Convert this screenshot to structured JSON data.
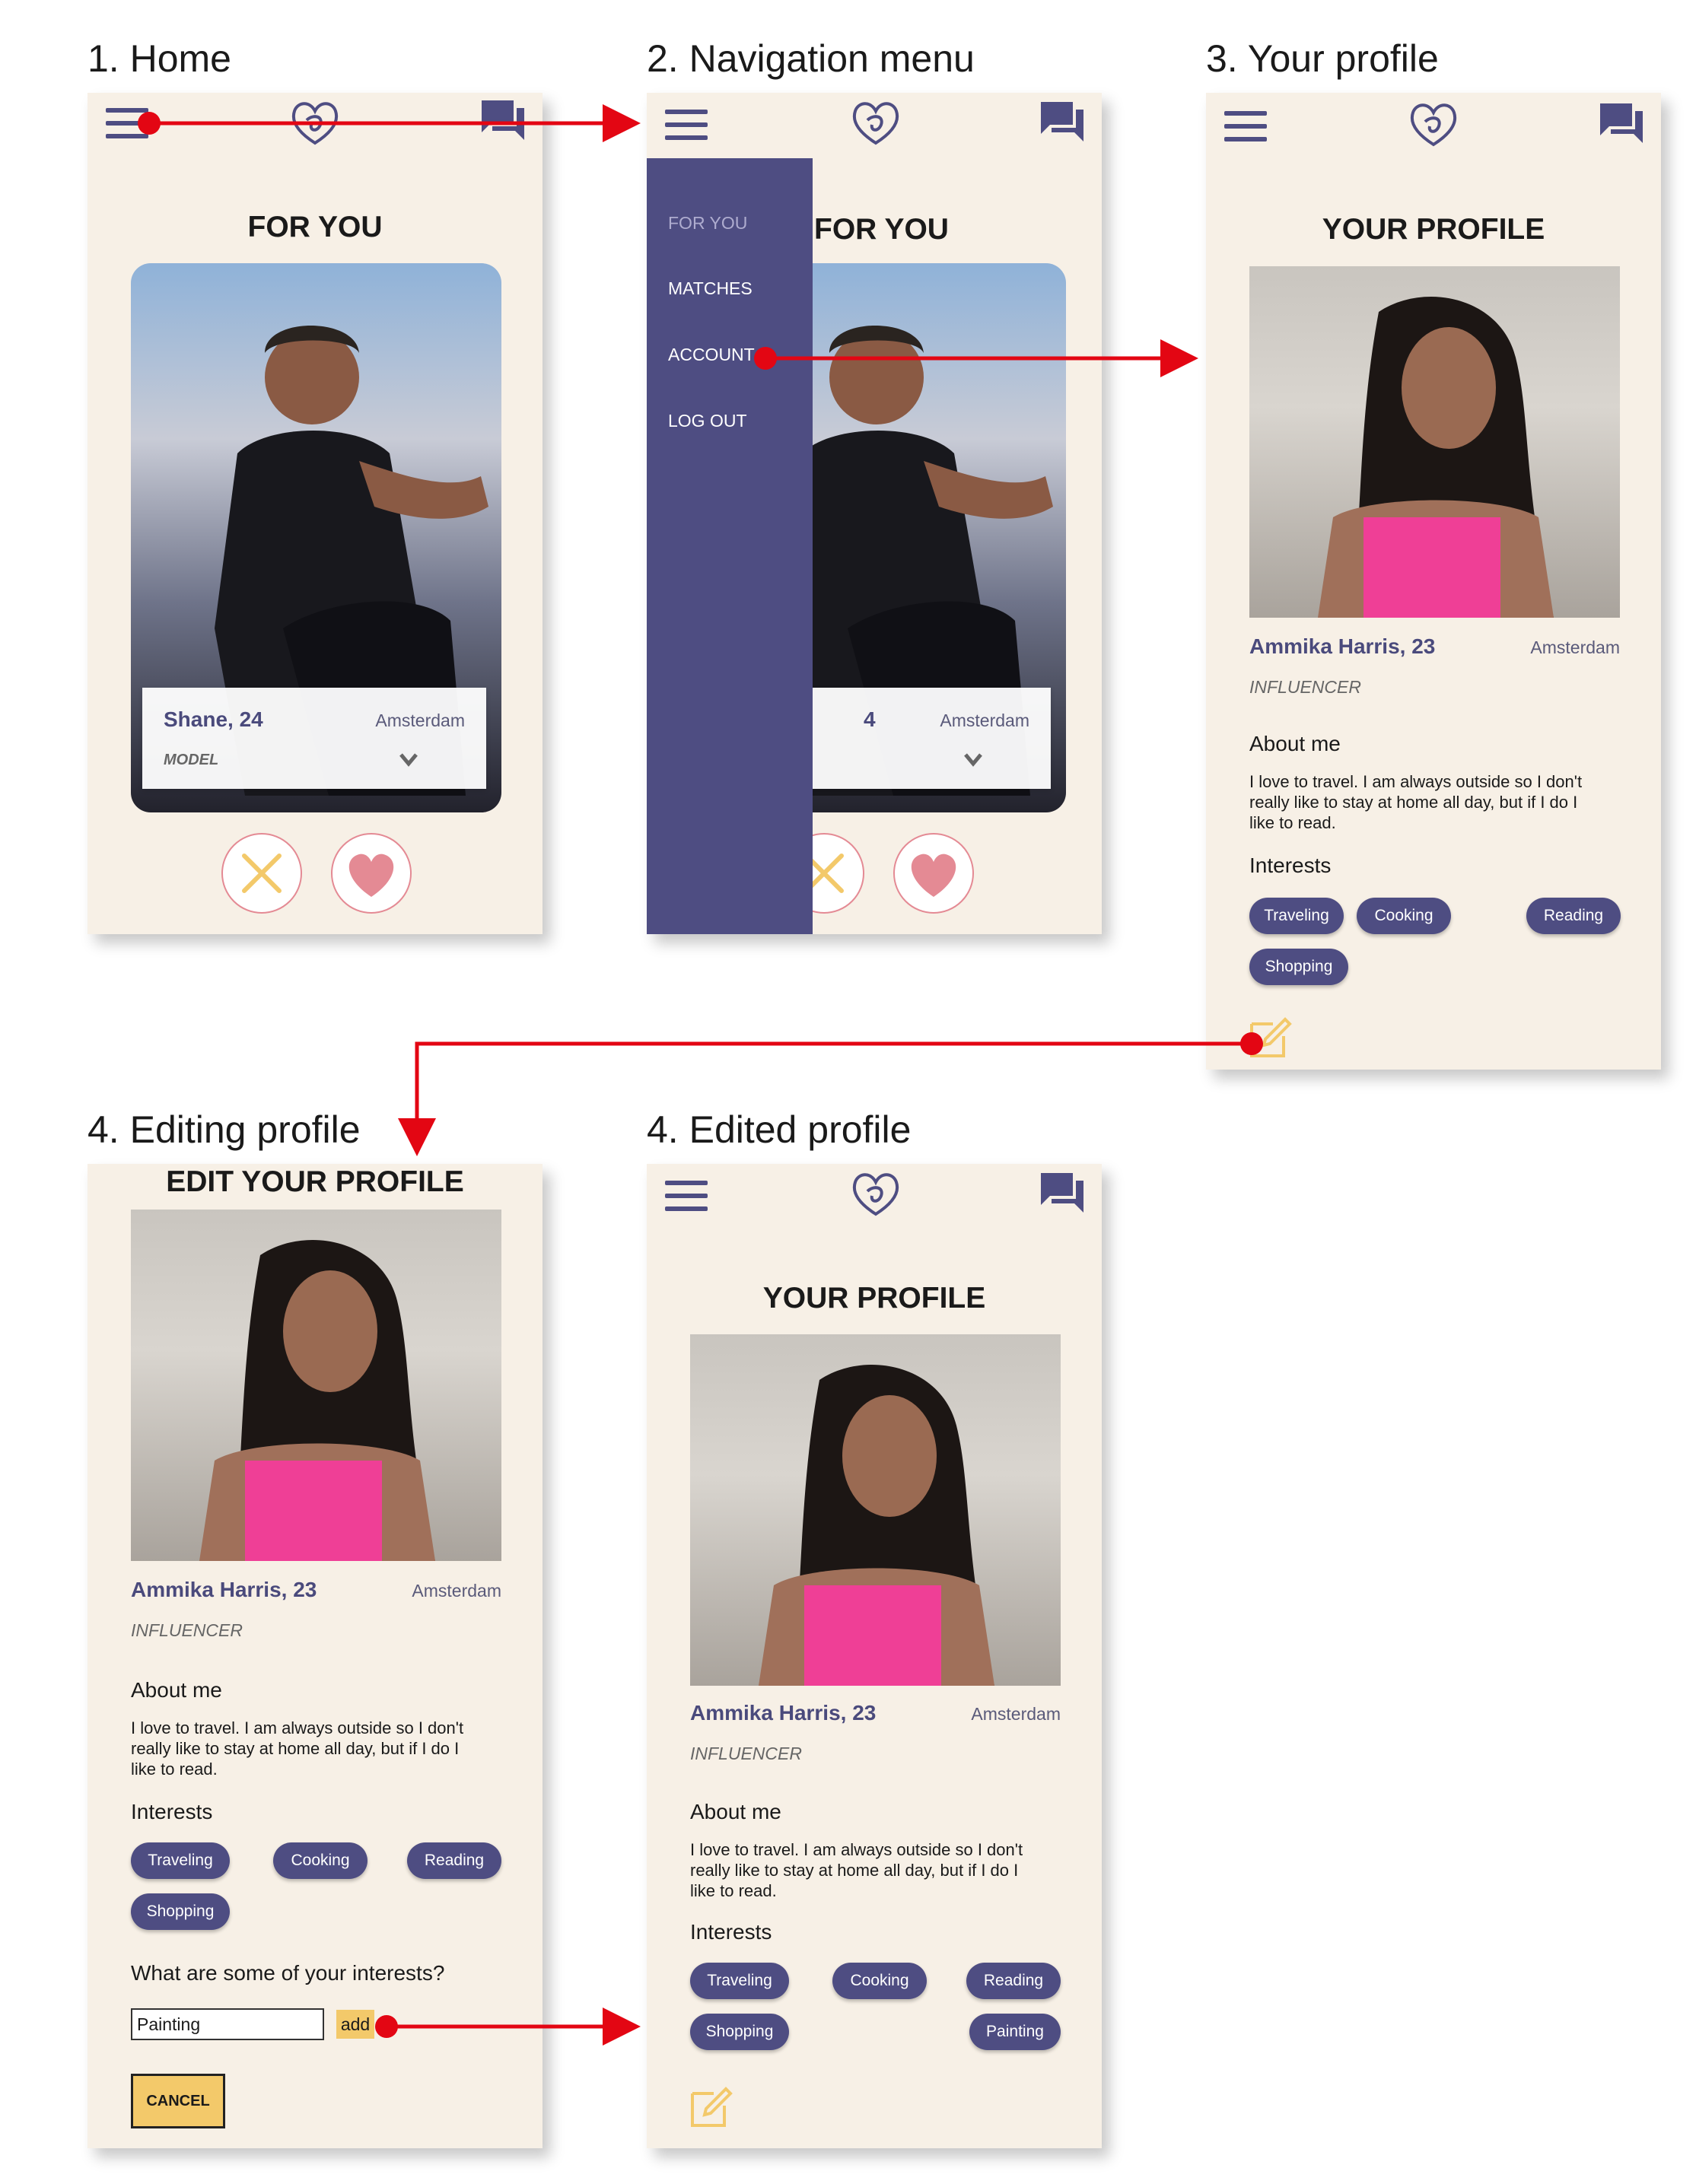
{
  "steps": {
    "home": "1. Home",
    "nav_menu": "2. Navigation menu",
    "your_profile": "3. Your profile",
    "editing_profile": "4. Editing profile",
    "edited_profile": "4. Edited profile"
  },
  "home": {
    "heading": "FOR YOU",
    "card": {
      "name": "Shane, 24",
      "city": "Amsterdam",
      "job": "MODEL"
    }
  },
  "nav": {
    "heading": "FOR YOU",
    "menu": [
      "FOR YOU",
      "MATCHES",
      "ACCOUNT",
      "LOG OUT"
    ],
    "card": {
      "name_fragment": "4",
      "city": "Amsterdam"
    }
  },
  "profile": {
    "heading": "YOUR PROFILE",
    "name": "Ammika Harris, 23",
    "city": "Amsterdam",
    "job": "INFLUENCER",
    "about_heading": "About me",
    "about_lines": [
      "I love to travel. I am always outside so I don't",
      "really like to stay at home all day, but if I do I",
      "like to read."
    ],
    "interests_heading": "Interests",
    "interests": [
      "Traveling",
      "Cooking",
      "Reading",
      "Shopping"
    ]
  },
  "edit": {
    "heading": "EDIT YOUR PROFILE",
    "question": "What are some of your interests?",
    "input_value": "Painting",
    "add_label": "add",
    "cancel_label": "CANCEL"
  },
  "edited": {
    "heading": "YOUR PROFILE",
    "interests": [
      "Traveling",
      "Cooking",
      "Reading",
      "Shopping",
      "Painting"
    ]
  },
  "colors": {
    "screen_bg": "#f7f0e6",
    "brand": "#4e4d82",
    "accent_yellow": "#f3c96a",
    "heart_pink": "#e48a94",
    "flow_arrow": "#e30613"
  },
  "icons": [
    "hamburger-icon",
    "heart-logo-icon",
    "chat-icon",
    "close-icon",
    "heart-icon",
    "chevron-down-icon",
    "edit-icon"
  ]
}
